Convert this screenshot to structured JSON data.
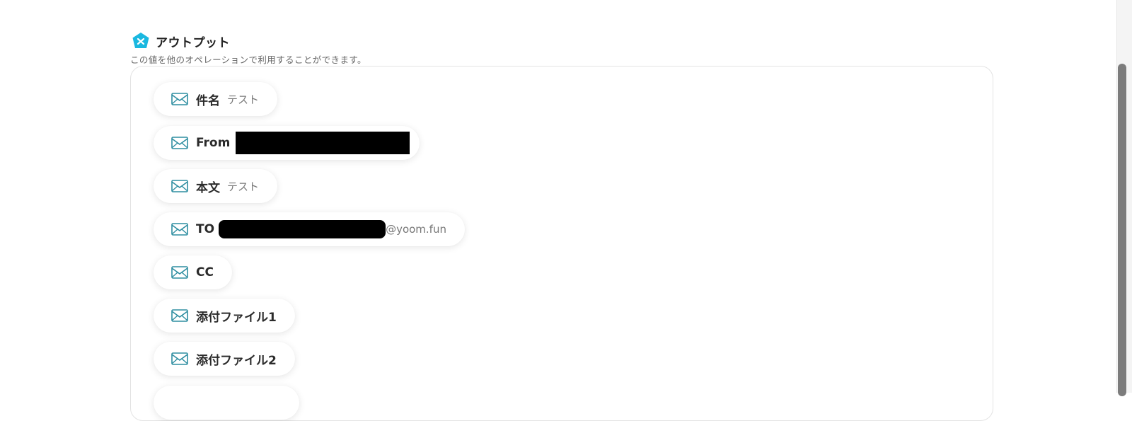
{
  "output": {
    "title": "アウトプット",
    "subtitle": "この値を他のオペレーションで利用することができます。"
  },
  "items": [
    {
      "label": "件名",
      "value": "テスト"
    },
    {
      "label": "From",
      "value": ""
    },
    {
      "label": "本文",
      "value": "テスト"
    },
    {
      "label": "TO",
      "value": "@yoom.fun"
    },
    {
      "label": "CC",
      "value": ""
    },
    {
      "label": "添付ファイル1",
      "value": ""
    },
    {
      "label": "添付ファイル2",
      "value": ""
    }
  ],
  "icons": {
    "section": "output-badge-icon",
    "item": "mail-icon"
  },
  "colors": {
    "accent": "#1ab8e0",
    "icon_teal": "#2f8ea1",
    "redaction": "#000000"
  }
}
